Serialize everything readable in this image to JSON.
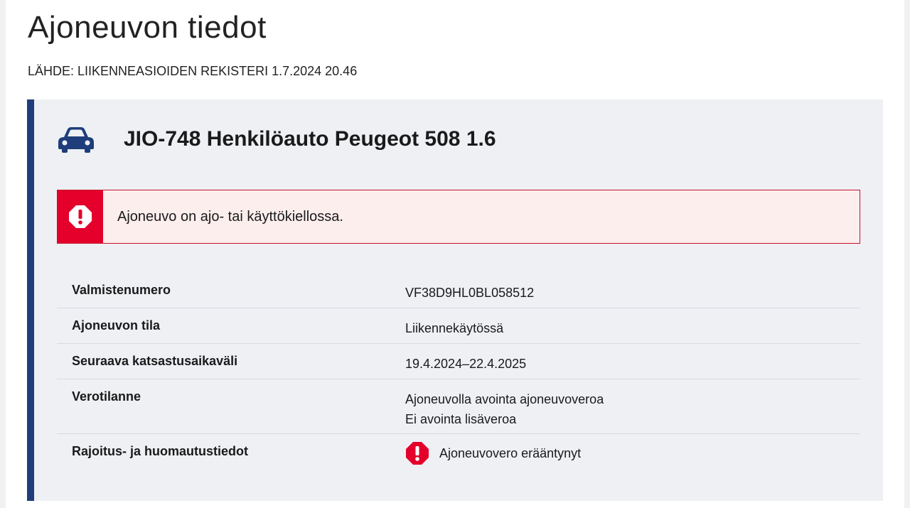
{
  "page": {
    "title": "Ajoneuvon tiedot",
    "source": "LÄHDE: LIIKENNEASIOIDEN REKISTERI 1.7.2024 20.46"
  },
  "vehicle": {
    "icon": "car-icon",
    "title": "JIO-748 Henkilöauto Peugeot 508 1.6"
  },
  "alert": {
    "icon": "warning-octagon-icon",
    "text": "Ajoneuvo on ajo- tai käyttökiellossa."
  },
  "details": [
    {
      "label": "Valmistenumero",
      "values": [
        "VF38D9HL0BL058512"
      ]
    },
    {
      "label": "Ajoneuvon tila",
      "values": [
        "Liikennekäytössä"
      ]
    },
    {
      "label": "Seuraava katsastusaikaväli",
      "values": [
        "19.4.2024–22.4.2025"
      ]
    },
    {
      "label": "Verotilanne",
      "values": [
        "Ajoneuvolla avointa ajoneuvoveroa",
        "Ei avointa lisäveroa"
      ]
    },
    {
      "label": "Rajoitus- ja huomautustiedot",
      "values": [
        "Ajoneuvovero erääntynyt"
      ],
      "icon": "warning-octagon-icon"
    }
  ],
  "colors": {
    "accent": "#1f3d7a",
    "alert_red": "#e4002b",
    "alert_bg": "#fdeeee",
    "card_bg": "#eef0f4"
  }
}
